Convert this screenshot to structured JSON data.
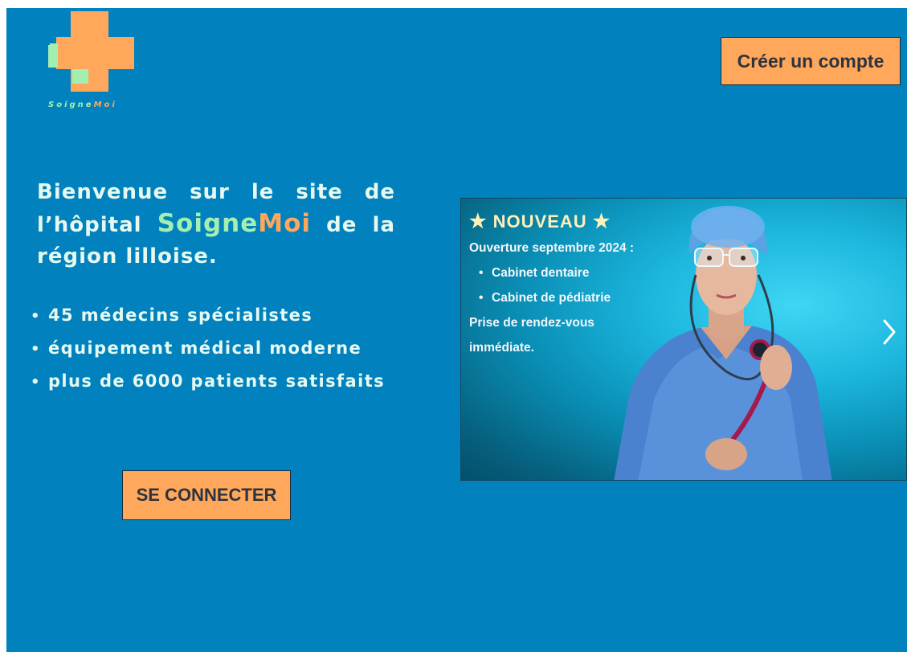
{
  "logo": {
    "text_part1": "Soigne",
    "text_part2": "Moi",
    "icon": "medical-cross-icon"
  },
  "header": {
    "create_account_label": "Créer un compte"
  },
  "hero": {
    "title_before": "Bienvenue sur le site de l’hôpital ",
    "brand_part1": "Soigne",
    "brand_part2": "Moi",
    "title_after": " de la région lilloise.",
    "features": [
      "45 médecins spécialistes",
      "équipement médical moderne",
      "plus de 6000 patients satisfaits"
    ],
    "bullet": "•",
    "login_label": "SE CONNECTER"
  },
  "carousel": {
    "badge_star": "★",
    "badge": "NOUVEAU",
    "opening": "Ouverture septembre 2024 :",
    "items": [
      "Cabinet dentaire",
      "Cabinet de pédiatrie"
    ],
    "booking_line1": "Prise de rendez-vous",
    "booking_line2": "immédiate.",
    "next_icon": "chevron-right-icon"
  },
  "colors": {
    "background": "#0181bd",
    "accent_orange": "#ffa75b",
    "accent_green": "#a3efb1",
    "text_light": "#e6f9f0"
  }
}
